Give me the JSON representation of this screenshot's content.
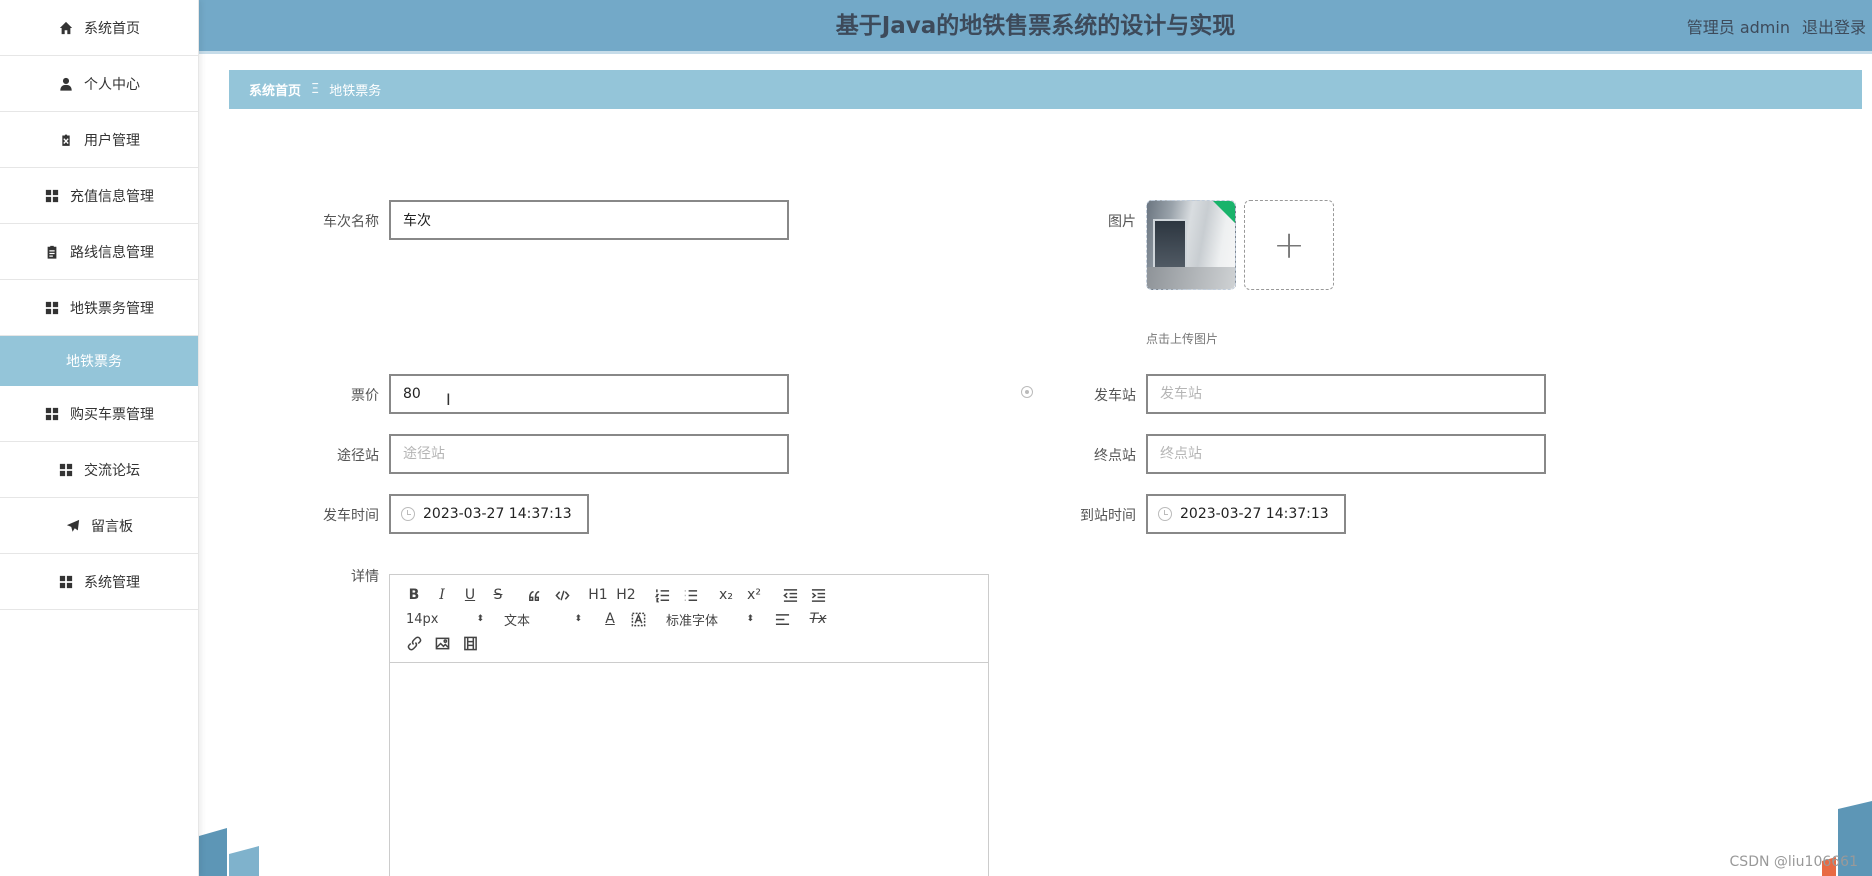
{
  "sidebar": {
    "items": [
      {
        "label": "系统首页",
        "icon": "home-icon"
      },
      {
        "label": "个人中心",
        "icon": "user-icon"
      },
      {
        "label": "用户管理",
        "icon": "clipboard-x-icon"
      },
      {
        "label": "充值信息管理",
        "icon": "grid-icon"
      },
      {
        "label": "路线信息管理",
        "icon": "clipboard-icon"
      },
      {
        "label": "地铁票务管理",
        "icon": "grid-icon"
      },
      {
        "label": "地铁票务",
        "icon": ""
      },
      {
        "label": "购买车票管理",
        "icon": "grid-icon"
      },
      {
        "label": "交流论坛",
        "icon": "grid-icon"
      },
      {
        "label": "留言板",
        "icon": "paper-plane-icon"
      },
      {
        "label": "系统管理",
        "icon": "grid-icon"
      }
    ]
  },
  "header": {
    "title": "基于Java的地铁售票系统的设计与实现",
    "user": "管理员 admin",
    "logout": "退出登录"
  },
  "breadcrumb": {
    "home": "系统首页",
    "separator": "Ξ",
    "current": "地铁票务"
  },
  "form": {
    "name": {
      "label": "车次名称",
      "value": "车次"
    },
    "image": {
      "label": "图片",
      "hint": "点击上传图片"
    },
    "price": {
      "label": "票价",
      "value": "80"
    },
    "departure_station": {
      "label": "发车站",
      "placeholder": "发车站"
    },
    "via_station": {
      "label": "途径站",
      "placeholder": "途径站"
    },
    "terminal_station": {
      "label": "终点站",
      "placeholder": "终点站"
    },
    "departure_time": {
      "label": "发车时间",
      "value": "2023-03-27 14:37:13"
    },
    "arrival_time": {
      "label": "到站时间",
      "value": "2023-03-27 14:37:13"
    },
    "details": {
      "label": "详情"
    }
  },
  "editor": {
    "font_size": "14px",
    "heading": "文本",
    "font_family": "标准字体",
    "bold": "B",
    "italic": "I",
    "underline": "U",
    "strike": "S",
    "h1": "H1",
    "h2": "H2",
    "sub": "x₂",
    "sup": "x²",
    "color": "A",
    "clear": "Tx"
  },
  "watermark": "CSDN @liu106661",
  "colors": {
    "header": "#73a9c8",
    "breadcrumb": "#94c5d9",
    "active_sub": "#94c5d9"
  }
}
